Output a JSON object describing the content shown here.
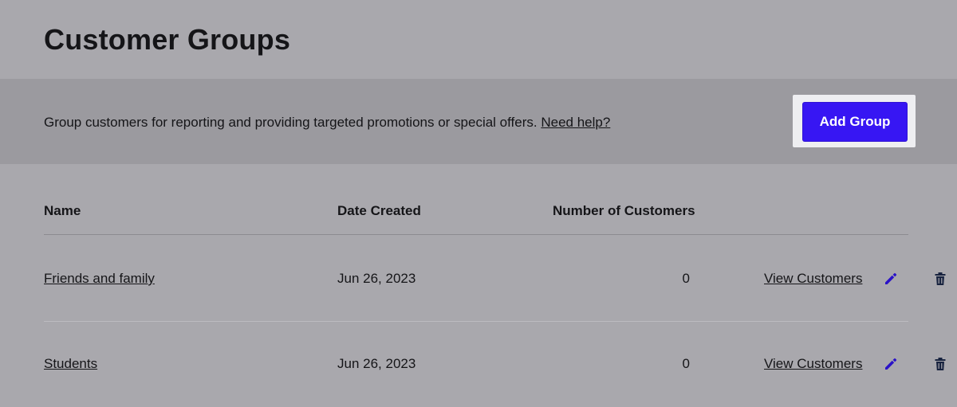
{
  "page": {
    "title": "Customer Groups"
  },
  "banner": {
    "description": "Group customers for reporting and providing targeted promotions or special offers.",
    "help_link": "Need help?",
    "add_button": "Add Group"
  },
  "table": {
    "columns": [
      "Name",
      "Date Created",
      "Number of Customers"
    ],
    "rows": [
      {
        "name": "Friends and family",
        "date_created": "Jun 26, 2023",
        "customers": "0",
        "view_link": "View Customers",
        "edit_icon": "pencil-icon",
        "delete_icon": "trash-icon"
      },
      {
        "name": "Students",
        "date_created": "Jun 26, 2023",
        "customers": "0",
        "view_link": "View Customers",
        "edit_icon": "pencil-icon",
        "delete_icon": "trash-icon"
      }
    ]
  },
  "colors": {
    "accent": "#3716f3",
    "background": "#a9a8ad",
    "banner": "#9b9a9f",
    "edit_icon": "#2a12c8",
    "delete_icon": "#18233f"
  }
}
